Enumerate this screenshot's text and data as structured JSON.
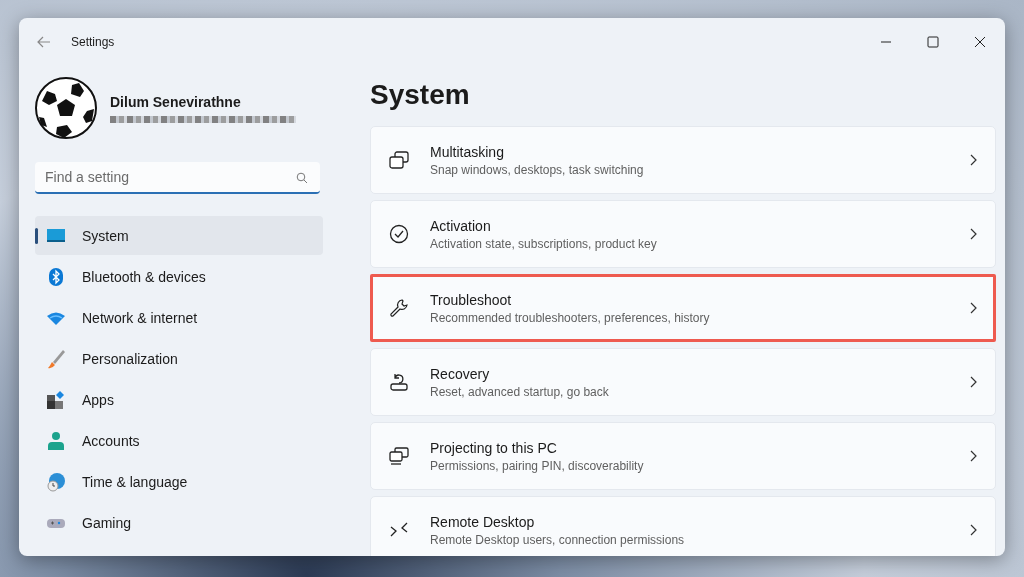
{
  "window": {
    "title": "Settings"
  },
  "profile": {
    "name": "Dilum Senevirathne"
  },
  "search": {
    "placeholder": "Find a setting"
  },
  "sidebar": {
    "items": [
      {
        "label": "System",
        "selected": true
      },
      {
        "label": "Bluetooth & devices",
        "selected": false
      },
      {
        "label": "Network & internet",
        "selected": false
      },
      {
        "label": "Personalization",
        "selected": false
      },
      {
        "label": "Apps",
        "selected": false
      },
      {
        "label": "Accounts",
        "selected": false
      },
      {
        "label": "Time & language",
        "selected": false
      },
      {
        "label": "Gaming",
        "selected": false
      }
    ]
  },
  "page": {
    "title": "System"
  },
  "cards": [
    {
      "title": "Multitasking",
      "subtitle": "Snap windows, desktops, task switching",
      "highlighted": false
    },
    {
      "title": "Activation",
      "subtitle": "Activation state, subscriptions, product key",
      "highlighted": false
    },
    {
      "title": "Troubleshoot",
      "subtitle": "Recommended troubleshooters, preferences, history",
      "highlighted": true
    },
    {
      "title": "Recovery",
      "subtitle": "Reset, advanced startup, go back",
      "highlighted": false
    },
    {
      "title": "Projecting to this PC",
      "subtitle": "Permissions, pairing PIN, discoverability",
      "highlighted": false
    },
    {
      "title": "Remote Desktop",
      "subtitle": "Remote Desktop users, connection permissions",
      "highlighted": false
    }
  ]
}
